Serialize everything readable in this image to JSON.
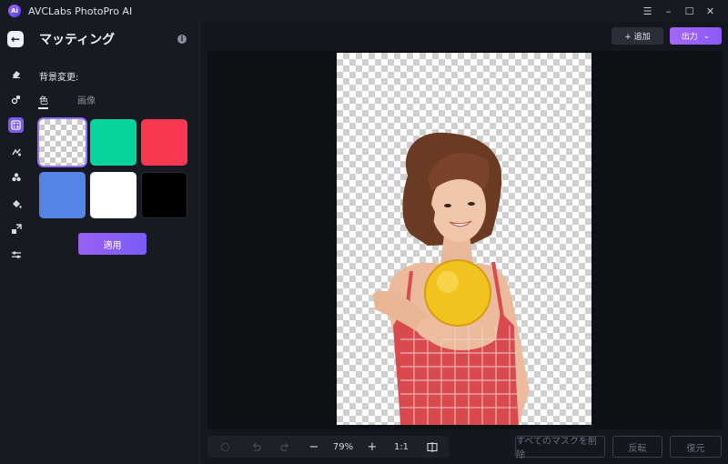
{
  "window": {
    "title": "AVCLabs PhotoPro AI",
    "logo_text": "Ai",
    "controls": {
      "menu": "☰",
      "minimize": "–",
      "maximize": "☐",
      "close": "✕"
    }
  },
  "rail": {
    "back": "←",
    "tools": [
      {
        "name": "eraser-icon",
        "glyph": "◇",
        "active": false
      },
      {
        "name": "retouch-icon",
        "glyph": "✥",
        "active": false
      },
      {
        "name": "matting-icon",
        "glyph": "⛶",
        "active": true
      },
      {
        "name": "enhance-icon",
        "glyph": "✺",
        "active": false
      },
      {
        "name": "colorize-icon",
        "glyph": "✤",
        "active": false
      },
      {
        "name": "fill-icon",
        "glyph": "◆",
        "active": false
      },
      {
        "name": "expand-icon",
        "glyph": "⤢",
        "active": false
      },
      {
        "name": "adjust-icon",
        "glyph": "⇄",
        "active": false
      }
    ]
  },
  "panel": {
    "title": "マッティング",
    "section_label": "背景変更:",
    "tabs": {
      "color": "色",
      "image": "画像"
    },
    "swatches": [
      {
        "name": "transparent",
        "color": "transparent",
        "selected": true
      },
      {
        "name": "green",
        "color": "#06d49a",
        "selected": false
      },
      {
        "name": "red",
        "color": "#f7384e",
        "selected": false
      },
      {
        "name": "blue",
        "color": "#5485e6",
        "selected": false
      },
      {
        "name": "white",
        "color": "#ffffff",
        "selected": false
      },
      {
        "name": "black",
        "color": "#000000",
        "selected": false
      }
    ],
    "apply_label": "適用"
  },
  "actions": {
    "add_label": "+ 追加",
    "export_label": "出力",
    "export_chevron": "⌄"
  },
  "toolbar": {
    "zoom": "79%",
    "ratio": "1:1",
    "zoom_out": "−",
    "zoom_in": "+"
  },
  "bottom_buttons": {
    "clear_masks": "すべてのマスクを削除",
    "invert": "反転",
    "restore": "復元"
  },
  "colors": {
    "accent": "#7a5cf5",
    "background": "#14171f"
  }
}
